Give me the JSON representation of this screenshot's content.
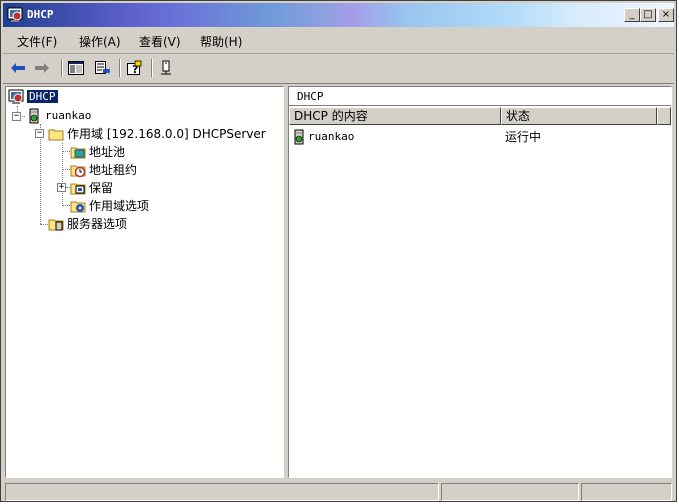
{
  "window": {
    "title": "DHCP"
  },
  "menu": [
    "文件(F)",
    "操作(A)",
    "查看(V)",
    "帮助(H)"
  ],
  "tree": {
    "root": "DHCP",
    "server": "ruankao",
    "scope": "作用域 [192.168.0.0] DHCPServer",
    "address_pool": "地址池",
    "address_leases": "地址租约",
    "reservations": "保留",
    "scope_options": "作用域选项",
    "server_options": "服务器选项"
  },
  "right": {
    "header": "DHCP",
    "columns": [
      "DHCP 的内容",
      "状态"
    ],
    "rows": [
      {
        "name": "ruankao",
        "status": "运行中"
      }
    ]
  },
  "colors": {
    "selection": "#0a246a",
    "face": "#d4d0c8"
  }
}
